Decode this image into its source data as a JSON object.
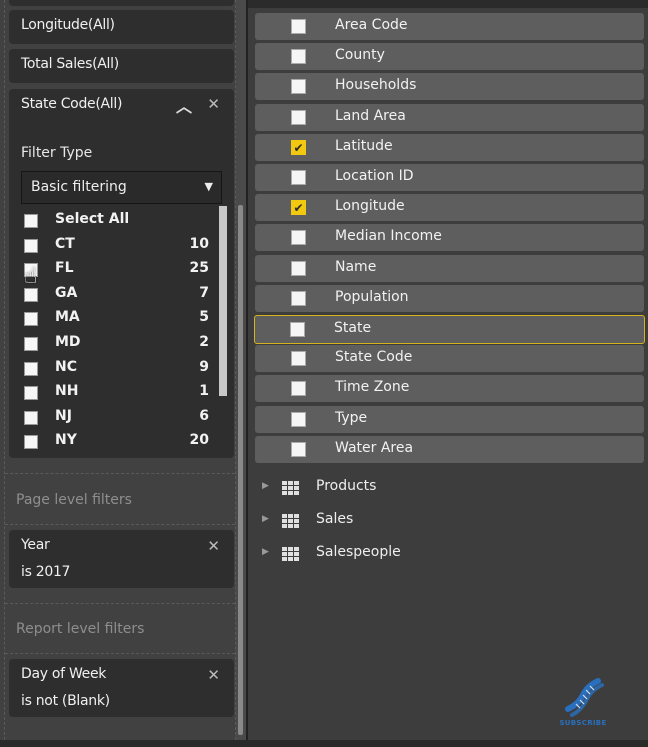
{
  "filters": {
    "visual_filters": [
      {
        "title": "Longitude(All)"
      },
      {
        "title": "Total Sales(All)"
      }
    ],
    "expanded_filter": {
      "title": "State Code(All)",
      "filter_type_label": "Filter Type",
      "filter_type_value": "Basic filtering",
      "items": [
        {
          "label": "Select All",
          "count": "",
          "checked": false
        },
        {
          "label": "CT",
          "count": "10",
          "checked": false
        },
        {
          "label": "FL",
          "count": "25",
          "checked": false
        },
        {
          "label": "GA",
          "count": "7",
          "checked": false
        },
        {
          "label": "MA",
          "count": "5",
          "checked": false
        },
        {
          "label": "MD",
          "count": "2",
          "checked": false
        },
        {
          "label": "NC",
          "count": "9",
          "checked": false
        },
        {
          "label": "NH",
          "count": "1",
          "checked": false
        },
        {
          "label": "NJ",
          "count": "6",
          "checked": false
        },
        {
          "label": "NY",
          "count": "20",
          "checked": false
        }
      ]
    },
    "page_level": {
      "label": "Page level filters",
      "card": {
        "title": "Year",
        "condition": "is 2017"
      }
    },
    "report_level": {
      "label": "Report level filters",
      "card": {
        "title": "Day of Week",
        "condition": "is not (Blank)"
      }
    }
  },
  "fields": {
    "items": [
      {
        "label": "Area Code",
        "checked": false
      },
      {
        "label": "County",
        "checked": false
      },
      {
        "label": "Households",
        "checked": false
      },
      {
        "label": "Land Area",
        "checked": false
      },
      {
        "label": "Latitude",
        "checked": true
      },
      {
        "label": "Location ID",
        "checked": false
      },
      {
        "label": "Longitude",
        "checked": true
      },
      {
        "label": "Median Income",
        "checked": false
      },
      {
        "label": "Name",
        "checked": false
      },
      {
        "label": "Population",
        "checked": false
      },
      {
        "label": "State",
        "checked": false,
        "selected": true
      },
      {
        "label": "State Code",
        "checked": false
      },
      {
        "label": "Time Zone",
        "checked": false
      },
      {
        "label": "Type",
        "checked": false
      },
      {
        "label": "Water Area",
        "checked": false
      }
    ],
    "tables": [
      {
        "label": "Products"
      },
      {
        "label": "Sales"
      },
      {
        "label": "Salespeople"
      }
    ]
  },
  "icons": {
    "close": "✕",
    "chevron_up": "︿",
    "dropdown_arrow": "▼",
    "expand_triangle": "▶",
    "check": "✔",
    "cursor": "☝"
  },
  "logo": {
    "text": "SUBSCRIBE"
  },
  "colors": {
    "accent": "#f2c811",
    "logo_blue": "#2a6fbd"
  }
}
